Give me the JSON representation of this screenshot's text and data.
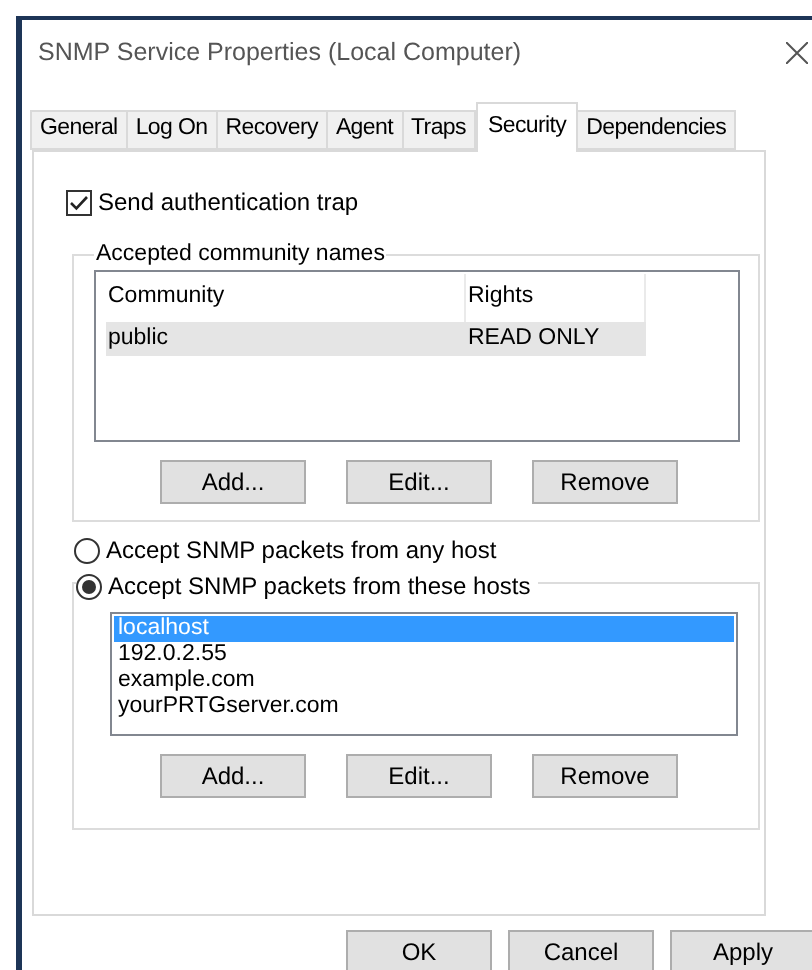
{
  "window": {
    "title": "SNMP Service Properties (Local Computer)"
  },
  "tabs": [
    {
      "label": "General",
      "selected": false
    },
    {
      "label": "Log On",
      "selected": false
    },
    {
      "label": "Recovery",
      "selected": false
    },
    {
      "label": "Agent",
      "selected": false
    },
    {
      "label": "Traps",
      "selected": false
    },
    {
      "label": "Security",
      "selected": true
    },
    {
      "label": "Dependencies",
      "selected": false
    }
  ],
  "send_auth_trap": {
    "label": "Send authentication trap",
    "checked": true
  },
  "community_group": {
    "title": "Accepted community names",
    "columns": [
      "Community",
      "Rights"
    ],
    "rows": [
      {
        "community": "public",
        "rights": "READ ONLY",
        "selected": true
      }
    ],
    "buttons": [
      "Add...",
      "Edit...",
      "Remove"
    ]
  },
  "host_options": [
    {
      "label": "Accept SNMP packets from any host",
      "selected": false
    },
    {
      "label": "Accept SNMP packets from these hosts",
      "selected": true
    }
  ],
  "hosts_group": {
    "hosts": [
      {
        "label": "localhost",
        "selected": true
      },
      {
        "label": "192.0.2.55",
        "selected": false
      },
      {
        "label": "example.com",
        "selected": false
      },
      {
        "label": "yourPRTGserver.com",
        "selected": false
      }
    ],
    "buttons": [
      "Add...",
      "Edit...",
      "Remove"
    ]
  },
  "dialog_buttons": [
    "OK",
    "Cancel",
    "Apply"
  ]
}
